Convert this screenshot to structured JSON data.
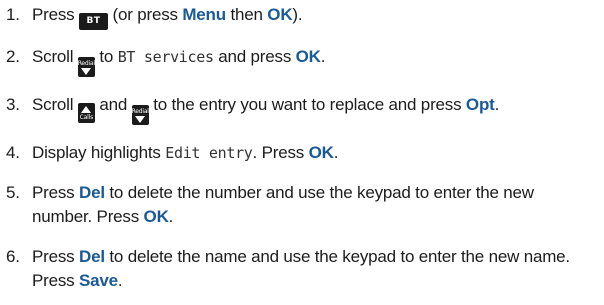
{
  "steps": [
    {
      "num": "1.",
      "press": "Press",
      "bt_key": "BT",
      "paren_open": "(or press",
      "menu": "Menu",
      "then": "then",
      "ok": "OK",
      "close": ")."
    },
    {
      "num": "2.",
      "scroll": "Scroll",
      "redial_key": "Redial",
      "to": "to",
      "bt_services": "BT services",
      "and_press": "and press",
      "ok": "OK",
      "end": "."
    },
    {
      "num": "3.",
      "scroll": "Scroll",
      "calls_key": "Calls",
      "and": "and",
      "redial_key": "Redial",
      "mid": "to the entry you want to replace and press",
      "opt": "Opt",
      "end": "."
    },
    {
      "num": "4.",
      "display": "Display highlights",
      "edit_entry": "Edit entry",
      "press": ". Press",
      "ok": "OK",
      "end": "."
    },
    {
      "num": "5.",
      "press": "Press",
      "del": "Del",
      "rest": "to delete the number and use the keypad to enter the new number. Press",
      "ok": "OK",
      "end": "."
    },
    {
      "num": "6.",
      "press": "Press",
      "del": "Del",
      "rest": "to delete the name and use the keypad to enter the new name. Press",
      "save": "Save",
      "end": "."
    }
  ],
  "colors": {
    "keyword": "#1a5a96",
    "text": "#1c1c1c",
    "key_bg": "#1b1b1b"
  },
  "icons": [
    "bt-key-icon",
    "redial-down-icon",
    "calls-up-icon"
  ]
}
